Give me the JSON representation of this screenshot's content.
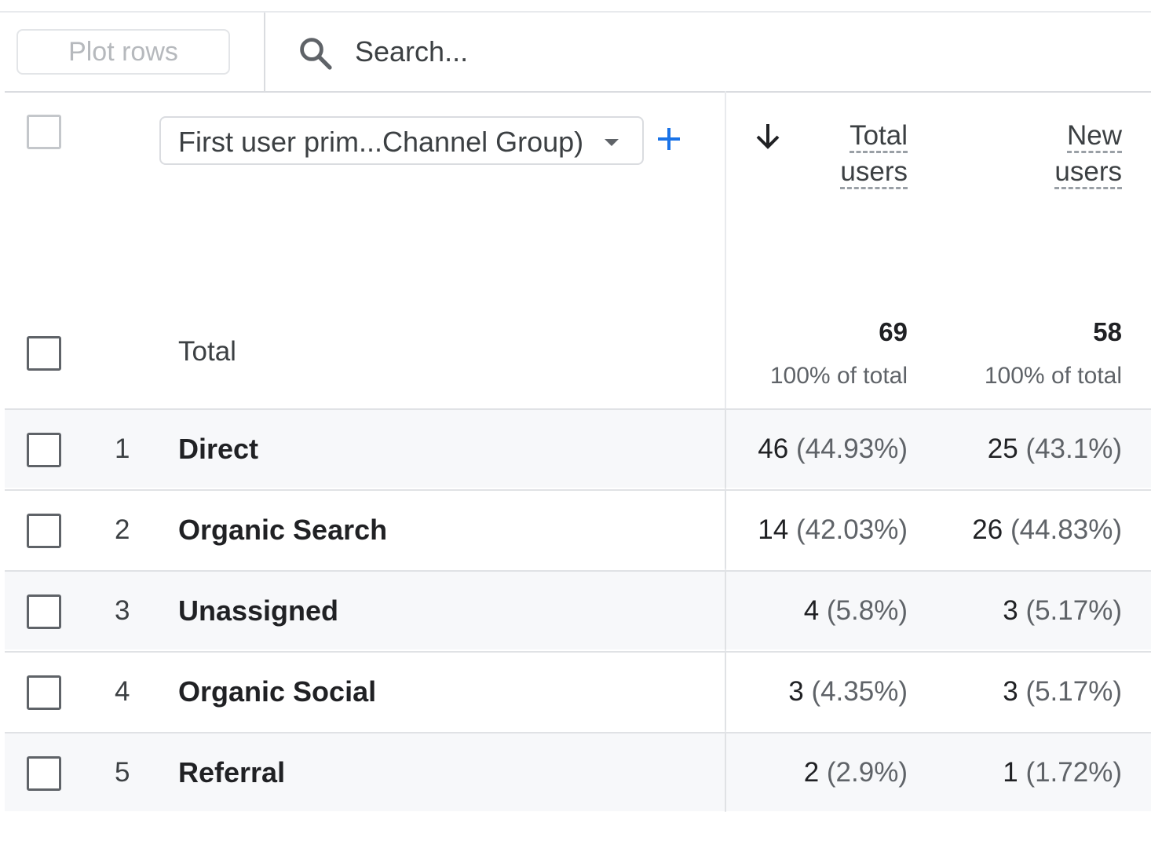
{
  "toolbar": {
    "plot_rows_label": "Plot rows",
    "search_placeholder": "Search..."
  },
  "header": {
    "dimension_label": "First user prim...Channel Group)",
    "columns": [
      {
        "line1": "Total",
        "line2": "users"
      },
      {
        "line1": "New",
        "line2": "users"
      }
    ]
  },
  "totals": {
    "label": "Total",
    "total_users": "69",
    "total_users_sub": "100% of total",
    "new_users": "58",
    "new_users_sub": "100% of total"
  },
  "rows": [
    {
      "rank": "1",
      "channel": "Direct",
      "total_users": "46",
      "total_users_pct": "(44.93%)",
      "new_users": "25",
      "new_users_pct": "(43.1%)"
    },
    {
      "rank": "2",
      "channel": "Organic Search",
      "total_users": "14",
      "total_users_pct": "(42.03%)",
      "new_users": "26",
      "new_users_pct": "(44.83%)"
    },
    {
      "rank": "3",
      "channel": "Unassigned",
      "total_users": "4",
      "total_users_pct": "(5.8%)",
      "new_users": "3",
      "new_users_pct": "(5.17%)"
    },
    {
      "rank": "4",
      "channel": "Organic Social",
      "total_users": "3",
      "total_users_pct": "(4.35%)",
      "new_users": "3",
      "new_users_pct": "(5.17%)"
    },
    {
      "rank": "5",
      "channel": "Referral",
      "total_users": "2",
      "total_users_pct": "(2.9%)",
      "new_users": "1",
      "new_users_pct": "(1.72%)"
    }
  ],
  "icons": {
    "search": "search-icon",
    "dropdown": "arrow-drop-down-icon",
    "add": "plus-icon",
    "sort": "arrow-down-icon"
  },
  "colors": {
    "accent": "#1a73e8",
    "row_shade": "#f7f8fa",
    "divider": "#e0e2e5"
  }
}
